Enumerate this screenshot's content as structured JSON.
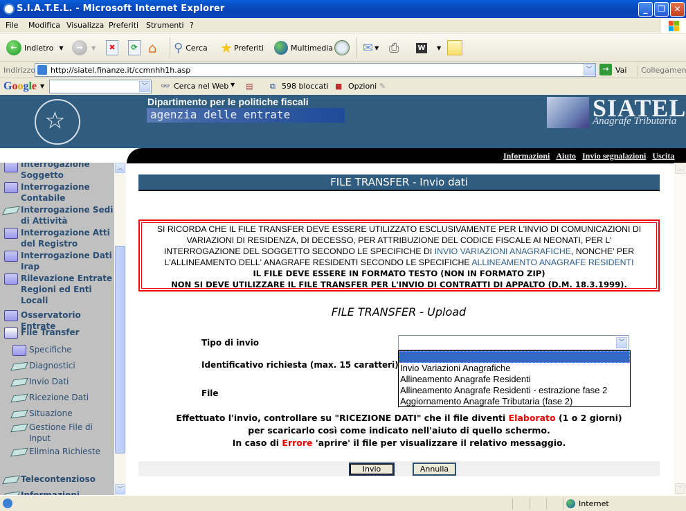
{
  "window": {
    "title": "S.I.A.T.E.L. - Microsoft Internet Explorer",
    "controls": [
      "minimize",
      "restore",
      "close"
    ]
  },
  "menubar": [
    "File",
    "Modifica",
    "Visualizza",
    "Preferiti",
    "Strumenti",
    "?"
  ],
  "toolbar": {
    "back": "Indietro",
    "search": "Cerca",
    "favorites": "Preferiti",
    "media": "Multimedia"
  },
  "address": {
    "label": "Indirizzo",
    "url": "http://siatel.finanze.it/ccmnhh1h.asp",
    "go": "Vai",
    "links": "Collegamenti"
  },
  "google": {
    "logo": "Google",
    "search_value": "",
    "search_web": "Cerca nel Web",
    "blocked": "598 bloccati",
    "options": "Opzioni"
  },
  "header": {
    "department": "Dipartimento per le politiche fiscali",
    "agency": "agenzia delle entrate",
    "brand": "SIATEL",
    "brand_sub": "Anagrafe Tributaria",
    "links": [
      "Informazioni",
      "Aiuto",
      "Invio segnalazioni",
      "Uscita"
    ]
  },
  "sidebar": {
    "items": [
      {
        "label": "Interrogazione Soggetto",
        "icon": "folder-icon",
        "level": 0
      },
      {
        "label": "Interrogazione Contabile",
        "icon": "folder-icon",
        "level": 0
      },
      {
        "label": "Interrogazione Sedi di Attività",
        "icon": "document-icon",
        "level": 0
      },
      {
        "label": "Interrogazione Atti del Registro",
        "icon": "folder-icon",
        "level": 0
      },
      {
        "label": "Interrogazione Dati Irap",
        "icon": "folder-icon",
        "level": 0
      },
      {
        "label": "Rilevazione Entrate Regioni ed Enti Locali",
        "icon": "folder-icon",
        "level": 0
      },
      {
        "label": "Osservatorio Entrate",
        "icon": "folder-icon",
        "level": 0
      },
      {
        "label": "File Transfer",
        "icon": "open-folder-icon",
        "level": 0
      },
      {
        "label": "Specifiche",
        "icon": "folder-icon",
        "level": 1
      },
      {
        "label": "Diagnostici",
        "icon": "document-icon",
        "level": 1
      },
      {
        "label": "Invio Dati",
        "icon": "document-icon",
        "level": 1
      },
      {
        "label": "Ricezione Dati",
        "icon": "document-icon",
        "level": 1
      },
      {
        "label": "Situazione",
        "icon": "document-icon",
        "level": 1
      },
      {
        "label": "Gestione File di Input",
        "icon": "document-icon",
        "level": 1
      },
      {
        "label": "Elimina Richieste",
        "icon": "document-icon",
        "level": 1
      },
      {
        "label": "Telecontenzioso",
        "icon": "document-icon",
        "level": 0
      },
      {
        "label": "Informazioni",
        "icon": "document-icon",
        "level": 0
      }
    ]
  },
  "main": {
    "section_title": "FILE TRANSFER - Invio dati",
    "notice": {
      "line1": "SI RICORDA CHE IL FILE TRANSFER DEVE ESSERE UTILIZZATO ESCLUSIVAMENTE PER L'INVIO DI COMUNICAZIONI DI",
      "line2": "VARIAZIONI DI RESIDENZA, DI DECESSO, PER ATTRIBUZIONE DEL CODICE FISCALE AI NEONATI, PER L'",
      "line3_pre": "INTERROGAZIONE DEL SOGGETTO SECONDO  LE SPECIFICHE DI ",
      "line3_link": "INVIO VARIAZIONI ANAGRAFICHE",
      "line3_post": ", NONCHE' PER",
      "line4_pre": "L'ALLINEAMENTO DELL' ANAGRAFE RESIDENTI SECONDO LE SPECIFICHE ",
      "line4_link": "ALLINEAMENTO ANAGRAFE RESIDENTI",
      "bold1": "IL FILE DEVE ESSERE IN FORMATO TESTO (NON IN FORMATO ZIP)",
      "bold2": "NON SI DEVE UTILIZZARE IL FILE TRANSFER PER L'INVIO DI CONTRATTI DI APPALTO (D.M. 18.3.1999)."
    },
    "upload_title": "FILE TRANSFER - Upload",
    "form": {
      "tipo_label": "Tipo di invio",
      "tipo_value": "",
      "tipo_options": [
        "",
        "Invio Variazioni Anagrafiche",
        "Allineamento Anagrafe Residenti",
        "Allineamento Anagrafe Residenti - estrazione fase 2",
        "Aggiornamento Anagrafe Tributaria (fase 2)"
      ],
      "id_label": "Identificativo richiesta (max. 15 caratteri)",
      "file_label": "File"
    },
    "info": {
      "l1_pre": "Effettuato l'invio, controllare su \"RICEZIONE DATI\" che il file diventi ",
      "l1_red": "Elaborato",
      "l1_post": " (1 o 2 giorni)",
      "l2": "per scaricarlo così come indicato nell'aiuto di quello schermo.",
      "l3_pre": "In caso di ",
      "l3_red": "Errore",
      "l3_post": " 'aprire' il file per visualizzare il relativo messaggio."
    },
    "buttons": {
      "submit": "Invio",
      "cancel": "Annulla"
    }
  },
  "statusbar": {
    "zone": "Internet"
  },
  "colors": {
    "header_blue": "#2f5c7f",
    "notice_red": "#ee0000",
    "link_blue": "#2b5c8f",
    "sidebar_text": "#2b4e72",
    "selection": "#316ac5"
  }
}
